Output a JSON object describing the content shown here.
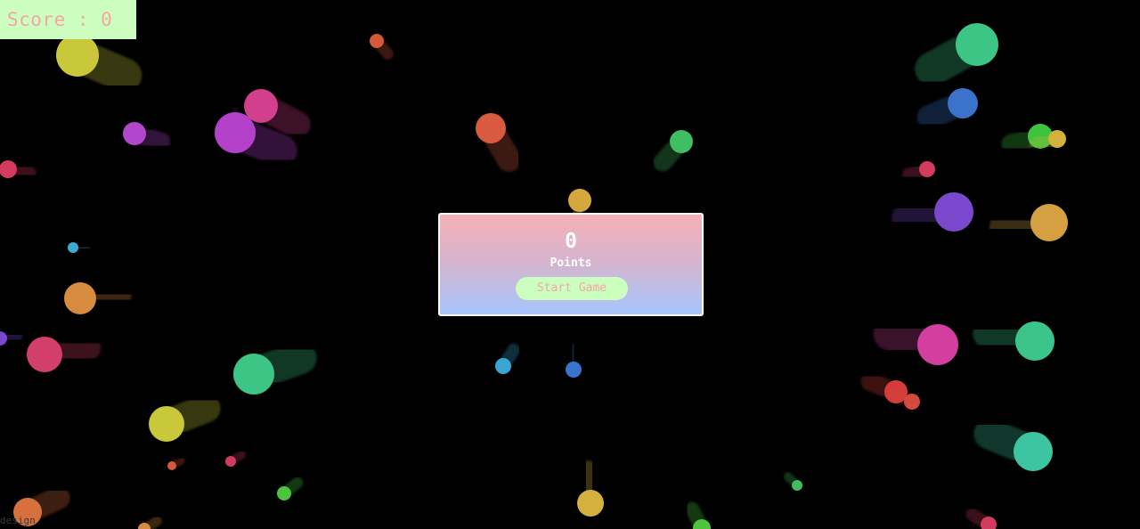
{
  "hud": {
    "score_text": "Score : 0"
  },
  "panel": {
    "score_value": "0",
    "points_label": "Points",
    "start_label": "Start Game"
  },
  "footer": {
    "credit_text": "design"
  },
  "colors": {
    "background": "#000000",
    "hud_bg": "#ccffbf",
    "hud_text": "#f4a6a6",
    "panel_top": "#f6b0b6",
    "panel_bottom": "#a7c5fd"
  }
}
